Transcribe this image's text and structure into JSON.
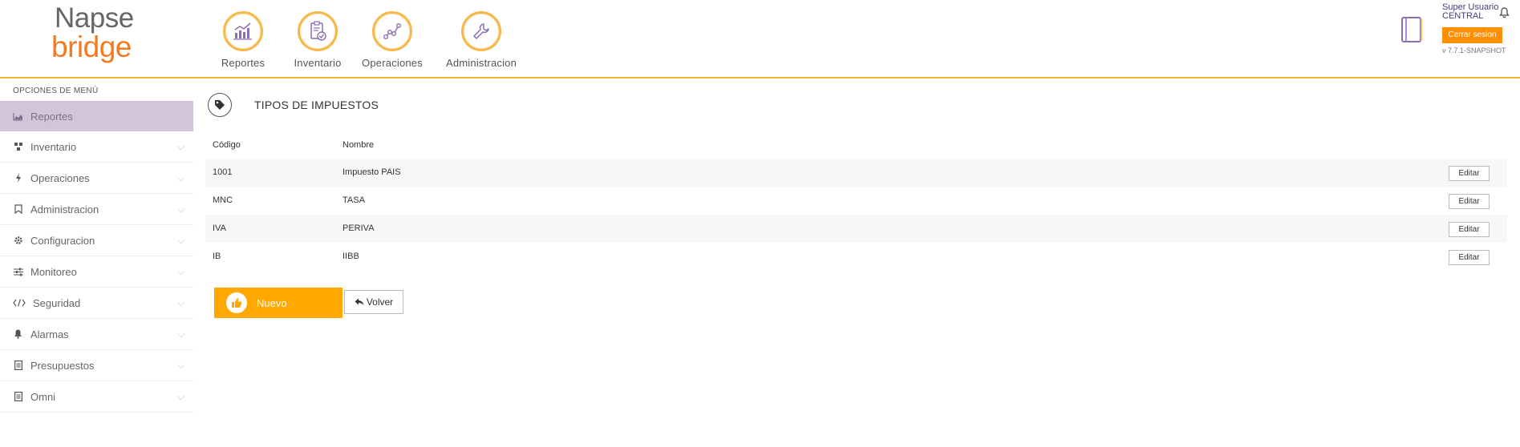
{
  "brand": {
    "line1": "Napse",
    "line2": "bridge"
  },
  "topnav": [
    {
      "label": "Reportes",
      "icon": "chart-report-icon"
    },
    {
      "label": "Inventario",
      "icon": "clipboard-check-icon"
    },
    {
      "label": "Operaciones",
      "icon": "graph-nodes-icon"
    },
    {
      "label": "Administracion",
      "icon": "wrench-icon"
    }
  ],
  "user": {
    "name": "Super Usuario",
    "branch": "CENTRAL",
    "logout_label": "Cerrar sesion",
    "version": "v 7.7.1-SNAPSHOT"
  },
  "sidebar": {
    "title": "OPCIONES DE MENÚ",
    "items": [
      {
        "label": "Reportes",
        "icon": "area-chart-icon",
        "active": true
      },
      {
        "label": "Inventario",
        "icon": "cubes-icon"
      },
      {
        "label": "Operaciones",
        "icon": "bolt-icon"
      },
      {
        "label": "Administracion",
        "icon": "bookmark-icon"
      },
      {
        "label": "Configuracion",
        "icon": "gear-icon"
      },
      {
        "label": "Monitoreo",
        "icon": "sliders-icon"
      },
      {
        "label": "Seguridad",
        "icon": "code-icon"
      },
      {
        "label": "Alarmas",
        "icon": "bell-icon"
      },
      {
        "label": "Presupuestos",
        "icon": "document-icon"
      },
      {
        "label": "Omni",
        "icon": "document-icon"
      }
    ]
  },
  "main": {
    "title": "TIPOS DE IMPUESTOS",
    "columns": {
      "code": "Código",
      "name": "Nombre"
    },
    "rows": [
      {
        "code": "1001",
        "name": "Impuesto PAIS",
        "action": "Editar"
      },
      {
        "code": "MNC",
        "name": "TASA",
        "action": "Editar"
      },
      {
        "code": "IVA",
        "name": "PERIVA",
        "action": "Editar"
      },
      {
        "code": "IB",
        "name": "IIBB",
        "action": "Editar"
      }
    ],
    "new_label": "Nuevo",
    "back_label": "Volver"
  },
  "colors": {
    "accent": "#ffa800",
    "logout": "#ff8f00",
    "active_sidebar": "#d3c5d9",
    "brand_orange": "#f47a1f"
  }
}
